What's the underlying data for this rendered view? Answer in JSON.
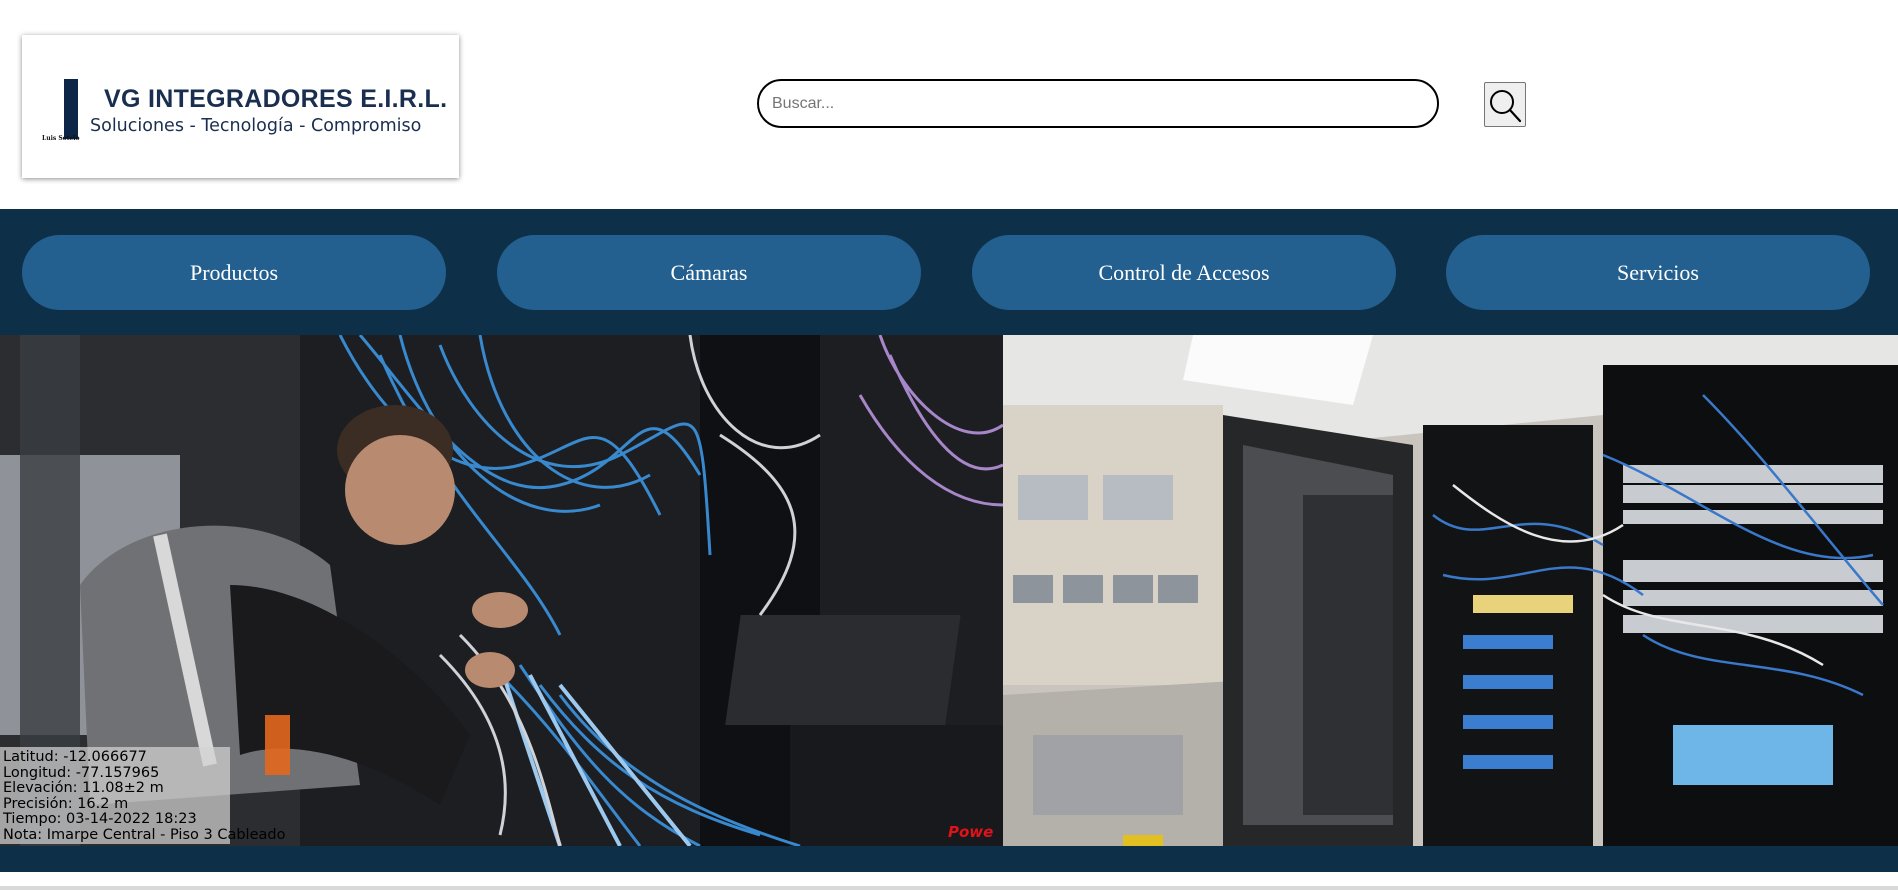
{
  "logo": {
    "company": "VG INTEGRADORES E.I.R.L.",
    "tagline": "Soluciones - Tecnología - Compromiso",
    "mini_text": "Luis Sotelo"
  },
  "search": {
    "placeholder": "Buscar...",
    "value": "",
    "button_icon": "search-icon"
  },
  "nav": {
    "items": [
      {
        "label": "Productos"
      },
      {
        "label": "Cámaras"
      },
      {
        "label": "Control de Accesos"
      },
      {
        "label": "Servicios"
      }
    ]
  },
  "photos": {
    "left": {
      "geotag": [
        "Latitud: -12.066677",
        "Longitud: -77.157965",
        "Elevación: 11.08±2 m",
        "Precisión: 16.2 m",
        "Tiempo: 03-14-2022 18:23",
        "Nota: Imarpe Central - Piso 3 Cableado"
      ],
      "watermark": "Powe"
    }
  },
  "colors": {
    "nav_background": "#0e2f48",
    "nav_button": "#23608f",
    "logo_navy": "#0d2546"
  }
}
